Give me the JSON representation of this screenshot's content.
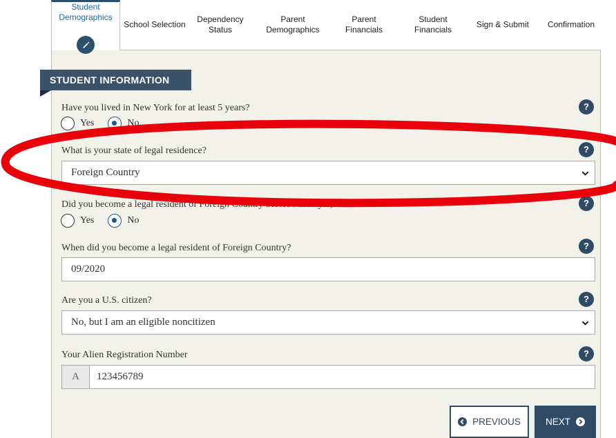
{
  "tabs": [
    {
      "line1": "Student",
      "line2": "Demographics",
      "active": true
    },
    {
      "line1": "School Selection",
      "line2": ""
    },
    {
      "line1": "Dependency",
      "line2": "Status"
    },
    {
      "line1": "Parent",
      "line2": "Demographics"
    },
    {
      "line1": "Parent",
      "line2": "Financials"
    },
    {
      "line1": "Student",
      "line2": "Financials"
    },
    {
      "line1": "Sign & Submit",
      "line2": ""
    },
    {
      "line1": "Confirmation",
      "line2": ""
    }
  ],
  "section_title": "STUDENT INFORMATION",
  "questions": {
    "lived_ny": {
      "label": "Have you lived in New York for at least 5 years?",
      "yes": "Yes",
      "no": "No",
      "selected": "No"
    },
    "state_residence": {
      "label": "What is your state of legal residence?",
      "value": "Foreign Country"
    },
    "resident_before": {
      "label": "Did you become a legal resident of Foreign Country before January 1, 2016?",
      "yes": "Yes",
      "no": "No",
      "selected": "No"
    },
    "resident_date": {
      "label": "When did you become a legal resident of Foreign Country?",
      "value": "09/2020"
    },
    "us_citizen": {
      "label": "Are you a U.S. citizen?",
      "value": "No, but I am an eligible noncitizen"
    },
    "alien_number": {
      "label": "Your Alien Registration Number",
      "prefix": "A",
      "value": "123456789"
    }
  },
  "help_glyph": "?",
  "buttons": {
    "previous": "PREVIOUS",
    "next": "NEXT"
  },
  "colors": {
    "navy": "#2f4b66",
    "panel": "#f2f1ea",
    "annotation": "#e8000b",
    "active_tab_text": "#1f6aa0"
  }
}
